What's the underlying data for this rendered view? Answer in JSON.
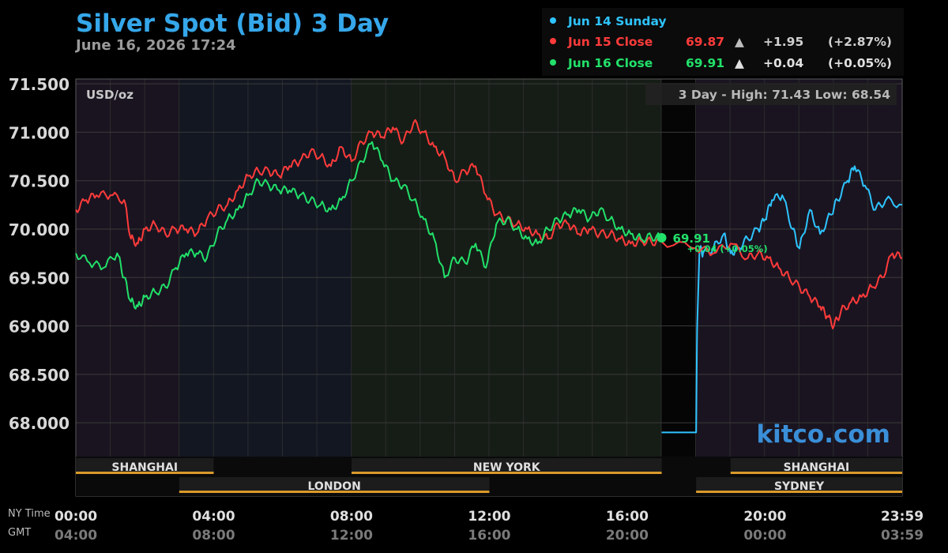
{
  "header": {
    "title": "Silver Spot (Bid) 3 Day",
    "timestamp": "June 16, 2026 17:24"
  },
  "legend": {
    "rows": [
      {
        "label": "Jun 14 Sunday",
        "price": "",
        "arrow": "",
        "change": "",
        "pct": "",
        "color": "#2ec4ff"
      },
      {
        "label": "Jun 15 Close",
        "price": "69.87",
        "arrow": "▲",
        "change": "+1.95",
        "pct": "(+2.87%)",
        "color": "#ff3b3b"
      },
      {
        "label": "Jun 16 Close",
        "price": "69.91",
        "arrow": "▲",
        "change": "+0.04",
        "pct": "(+0.05%)",
        "color": "#22e06a"
      }
    ]
  },
  "plot": {
    "unit_label": "USD/oz",
    "range_text": "3 Day - High: 71.43  Low: 68.54",
    "last_price": "69.91",
    "last_change": "+0.04 (+0.05%)",
    "watermark": "kitco.com",
    "time_axis_label_ny": "NY Time",
    "time_axis_label_gmt": "GMT"
  },
  "sessions": {
    "row1": [
      {
        "name": "SHANGHAI",
        "start": 0,
        "end": 4
      },
      {
        "name": "NEW YORK",
        "start": 8,
        "end": 17
      },
      {
        "name": "SHANGHAI",
        "start": 19,
        "end": 23.98
      }
    ],
    "row2": [
      {
        "name": "LONDON",
        "start": 3,
        "end": 12
      },
      {
        "name": "SYDNEY",
        "start": 18,
        "end": 23.98
      }
    ]
  },
  "chart_data": {
    "type": "line",
    "title": "Silver Spot (Bid) 3 Day",
    "ylabel": "USD/oz",
    "xlim": [
      0,
      23.98
    ],
    "ylim": [
      67.65,
      71.55
    ],
    "yticks": [
      "71.500",
      "71.000",
      "70.500",
      "70.000",
      "69.500",
      "69.000",
      "68.500",
      "68.000"
    ],
    "ytick_values": [
      71.5,
      71.0,
      70.5,
      70.0,
      69.5,
      69.0,
      68.5,
      68.0
    ],
    "xticks_ny": [
      "00:00",
      "04:00",
      "08:00",
      "12:00",
      "16:00",
      "20:00",
      "23:59"
    ],
    "xticks_gmt": [
      "04:00",
      "08:00",
      "12:00",
      "16:00",
      "20:00",
      "00:00",
      "03:59"
    ],
    "xtick_hours": [
      0,
      4,
      8,
      12,
      16,
      20,
      23.98
    ],
    "grid": true,
    "high": 71.43,
    "low": 68.54,
    "series": [
      {
        "name": "Jun 14 Sunday",
        "color": "#2ec4ff",
        "x": [
          17.0,
          18.0,
          18.03,
          18.1,
          18.2,
          18.5,
          18.8,
          19.0,
          19.2,
          19.5,
          19.8,
          20.0,
          20.2,
          20.5,
          20.8,
          21.0,
          21.3,
          21.6,
          21.9,
          22.1,
          22.4,
          22.6,
          22.9,
          23.2,
          23.5,
          23.98
        ],
        "y": [
          67.9,
          67.9,
          69.0,
          69.8,
          69.75,
          69.8,
          69.95,
          69.75,
          69.8,
          69.9,
          70.0,
          70.1,
          70.3,
          70.35,
          70.0,
          69.8,
          70.2,
          69.95,
          70.15,
          70.3,
          70.5,
          70.65,
          70.45,
          70.2,
          70.3,
          70.25
        ]
      },
      {
        "name": "Jun 15 Close",
        "color": "#ff3b3b",
        "x": [
          0,
          0.3,
          0.6,
          1.0,
          1.4,
          1.6,
          1.8,
          2.0,
          2.3,
          2.6,
          2.9,
          3.2,
          3.5,
          3.8,
          4.1,
          4.4,
          4.7,
          5.0,
          5.3,
          5.6,
          5.9,
          6.2,
          6.5,
          6.8,
          7.1,
          7.4,
          7.7,
          8.0,
          8.3,
          8.6,
          8.9,
          9.2,
          9.5,
          9.8,
          10.1,
          10.4,
          10.7,
          11.0,
          11.3,
          11.6,
          11.9,
          12.2,
          12.5,
          12.8,
          13.1,
          13.4,
          13.7,
          14.0,
          14.3,
          14.6,
          14.9,
          15.2,
          15.5,
          15.8,
          16.1,
          16.4,
          16.7,
          17.0,
          18.0,
          18.5,
          19.0,
          19.5,
          19.8,
          20.1,
          20.4,
          20.7,
          21.0,
          21.3,
          21.6,
          21.8,
          22.0,
          22.2,
          22.5,
          22.8,
          23.1,
          23.4,
          23.7,
          23.98
        ],
        "y": [
          70.2,
          70.3,
          70.35,
          70.35,
          70.3,
          69.9,
          69.85,
          70.0,
          70.05,
          69.95,
          70.0,
          70.0,
          69.95,
          70.1,
          70.2,
          70.25,
          70.4,
          70.55,
          70.6,
          70.6,
          70.55,
          70.65,
          70.7,
          70.8,
          70.75,
          70.65,
          70.85,
          70.7,
          70.9,
          71.0,
          70.95,
          71.05,
          70.9,
          71.1,
          71.0,
          70.85,
          70.75,
          70.5,
          70.6,
          70.65,
          70.35,
          70.15,
          70.1,
          70.05,
          70.0,
          69.95,
          69.9,
          70.05,
          70.05,
          69.95,
          70.0,
          69.95,
          69.95,
          69.9,
          69.85,
          69.88,
          69.87,
          69.87,
          69.8,
          69.75,
          69.85,
          69.7,
          69.75,
          69.7,
          69.6,
          69.5,
          69.4,
          69.3,
          69.2,
          69.1,
          69.0,
          69.15,
          69.25,
          69.3,
          69.4,
          69.5,
          69.75,
          69.7
        ]
      },
      {
        "name": "Jun 16 Close",
        "color": "#22e06a",
        "x": [
          0,
          0.4,
          0.8,
          1.2,
          1.4,
          1.6,
          1.8,
          2.0,
          2.3,
          2.6,
          2.9,
          3.2,
          3.5,
          3.8,
          4.1,
          4.4,
          4.7,
          5.0,
          5.3,
          5.6,
          5.9,
          6.2,
          6.5,
          6.8,
          7.1,
          7.4,
          7.7,
          8.0,
          8.3,
          8.6,
          8.9,
          9.2,
          9.5,
          9.8,
          10.1,
          10.4,
          10.7,
          11.0,
          11.3,
          11.6,
          11.9,
          12.2,
          12.5,
          12.8,
          13.1,
          13.4,
          13.7,
          14.0,
          14.3,
          14.6,
          14.9,
          15.2,
          15.5,
          15.8,
          16.1,
          16.4,
          16.7,
          17.0
        ],
        "y": [
          69.75,
          69.65,
          69.6,
          69.75,
          69.5,
          69.25,
          69.2,
          69.3,
          69.35,
          69.4,
          69.6,
          69.75,
          69.75,
          69.7,
          69.95,
          70.1,
          70.2,
          70.35,
          70.5,
          70.45,
          70.4,
          70.4,
          70.35,
          70.3,
          70.25,
          70.2,
          70.3,
          70.5,
          70.7,
          70.9,
          70.7,
          70.5,
          70.45,
          70.3,
          70.1,
          69.9,
          69.5,
          69.7,
          69.65,
          69.85,
          69.6,
          70.05,
          70.1,
          70.0,
          69.9,
          69.85,
          70.0,
          70.1,
          70.15,
          70.2,
          70.1,
          70.2,
          70.1,
          70.0,
          69.95,
          69.9,
          69.92,
          69.91
        ]
      }
    ]
  }
}
